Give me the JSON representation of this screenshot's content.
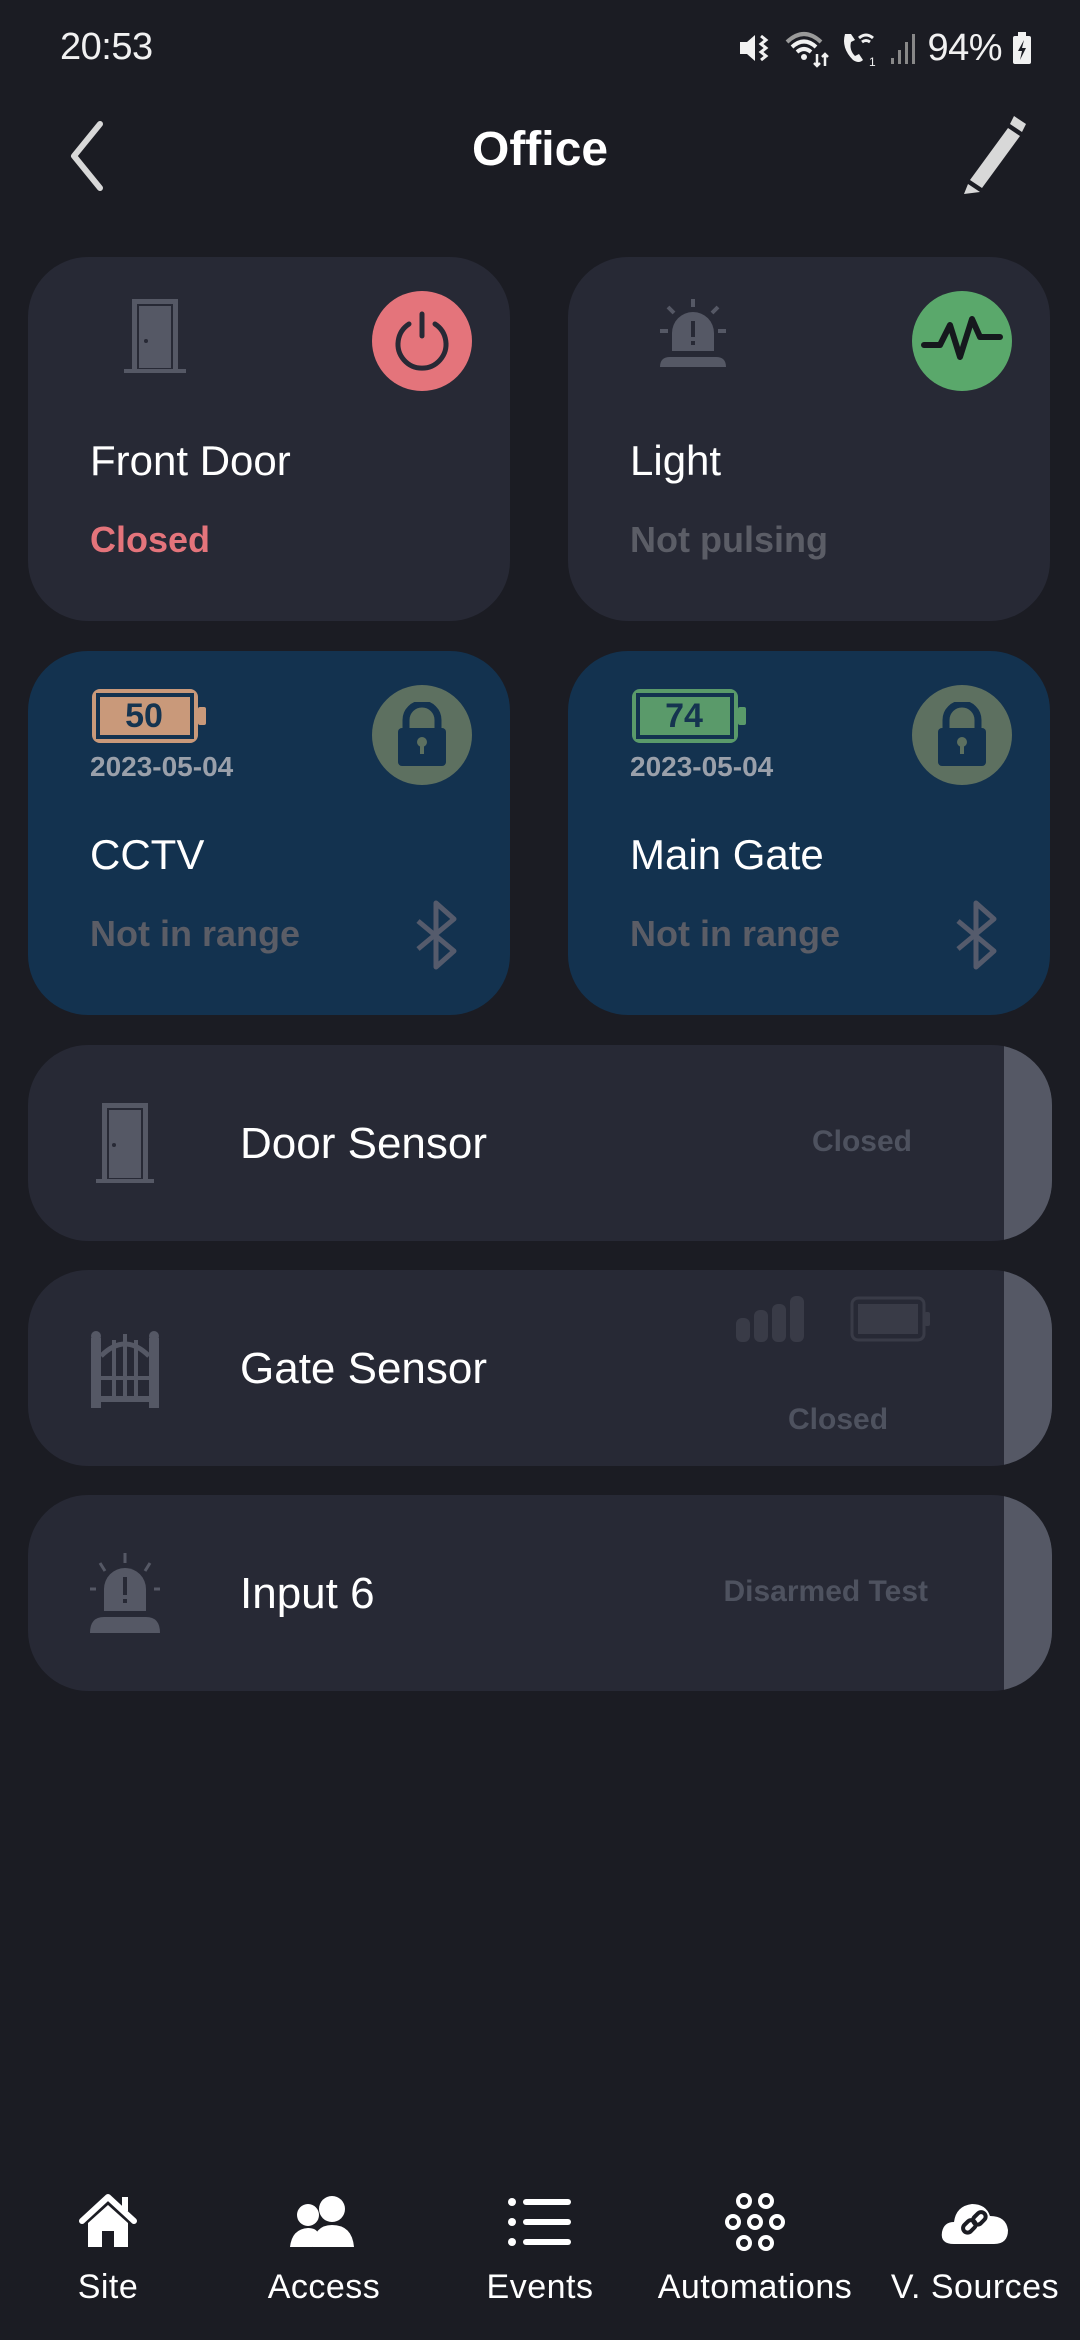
{
  "status_bar": {
    "time": "20:53",
    "battery_percent": "94%",
    "icons": [
      "mute-vibrate-icon",
      "wifi-icon",
      "wifi-calling-icon",
      "cell-signal-icon",
      "battery-charging-icon"
    ]
  },
  "header": {
    "title": "Office",
    "back_icon": "chevron-left-icon",
    "edit_icon": "pencil-icon"
  },
  "tiles": [
    {
      "name": "Front Door",
      "status": "Closed",
      "status_color": "#e4747b",
      "icon": "door-icon",
      "action_icon": "power-icon",
      "action_color": "#e4747b"
    },
    {
      "name": "Light",
      "status": "Not pulsing",
      "status_color": "#5b5d66",
      "icon": "siren-icon",
      "action_icon": "pulse-icon",
      "action_color": "#5aa86b"
    },
    {
      "name": "CCTV",
      "status": "Not in range",
      "status_color": "#5b5d66",
      "battery": "50",
      "battery_color": "#c9997a",
      "date": "2023-05-04",
      "action_icon": "lock-icon",
      "action_color": "#5d7060",
      "connection_icon": "bluetooth-icon"
    },
    {
      "name": "Main Gate",
      "status": "Not in range",
      "status_color": "#5b5d66",
      "battery": "74",
      "battery_color": "#5a9a6a",
      "date": "2023-05-04",
      "action_icon": "lock-icon",
      "action_color": "#5d7060",
      "connection_icon": "bluetooth-icon"
    }
  ],
  "rows": [
    {
      "name": "Door Sensor",
      "status": "Closed",
      "icon": "door-icon"
    },
    {
      "name": "Gate Sensor",
      "status": "Closed",
      "icon": "gate-icon",
      "extra_icons": [
        "signal-strength-icon",
        "battery-icon"
      ]
    },
    {
      "name": "Input 6",
      "status": "Disarmed Test",
      "icon": "siren-icon"
    }
  ],
  "bottom_nav": [
    {
      "label": "Site",
      "icon": "home-icon"
    },
    {
      "label": "Access",
      "icon": "users-icon"
    },
    {
      "label": "Events",
      "icon": "list-icon"
    },
    {
      "label": "Automations",
      "icon": "automations-icon"
    },
    {
      "label": "V. Sources",
      "icon": "cloud-link-icon"
    }
  ]
}
